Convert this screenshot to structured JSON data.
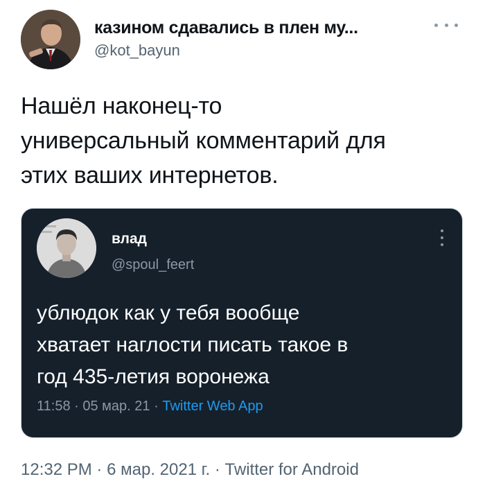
{
  "tweet": {
    "author_name": "казином сдавались в плен му...",
    "author_handle": "@kot_bayun",
    "more_icon": "more-horizontal-icon",
    "text_lines": [
      "Нашёл наконец-то",
      "универсальный комментарий для",
      "этих ваших интернетов."
    ],
    "time": "12:32 PM",
    "separator": "·",
    "date": "6 мар. 2021 г.",
    "source": "Twitter for Android"
  },
  "quoted_tweet": {
    "author_name": "влад",
    "author_handle": "@spoul_feert",
    "more_icon": "more-vertical-icon",
    "text_lines": [
      "ублюдок как у тебя вообще",
      "хватает наглости писать такое в",
      "год 435-летия воронежа"
    ],
    "time": "11:58",
    "separator": "·",
    "date": "05 мар. 21",
    "source": "Twitter Web App"
  },
  "colors": {
    "background": "#ffffff",
    "text_primary": "#0f1419",
    "text_secondary": "#536471",
    "card_background": "#15202b",
    "card_text": "#ffffff",
    "card_secondary": "#8b98a5",
    "link": "#1d9bf0"
  }
}
